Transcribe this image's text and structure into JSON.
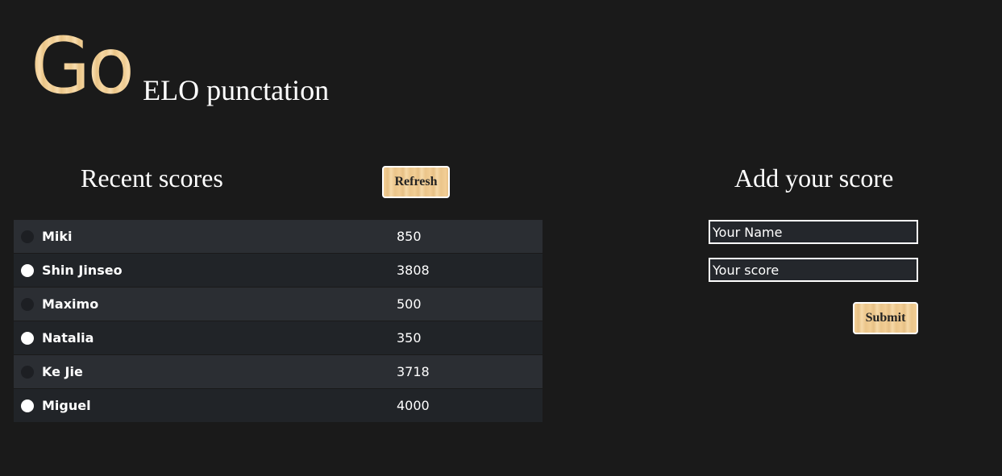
{
  "header": {
    "logo": "Go",
    "subtitle": "ELO punctation"
  },
  "recent": {
    "title": "Recent scores",
    "refresh_label": "Refresh",
    "rows": [
      {
        "stone": "black",
        "name": "Miki",
        "score": "850"
      },
      {
        "stone": "white",
        "name": "Shin Jinseo",
        "score": "3808"
      },
      {
        "stone": "black",
        "name": "Maximo",
        "score": "500"
      },
      {
        "stone": "white",
        "name": "Natalia",
        "score": "350"
      },
      {
        "stone": "black",
        "name": "Ke Jie",
        "score": "3718"
      },
      {
        "stone": "white",
        "name": "Miguel",
        "score": "4000"
      }
    ]
  },
  "add": {
    "title": "Add your score",
    "name_placeholder": "Your Name",
    "name_value": "",
    "score_placeholder": "Your score",
    "score_value": "",
    "submit_label": "Submit"
  },
  "colors": {
    "background": "#1a1a1a",
    "row_light": "#2b2e33",
    "row_dark": "#212428",
    "wood": "#f3cf96"
  }
}
